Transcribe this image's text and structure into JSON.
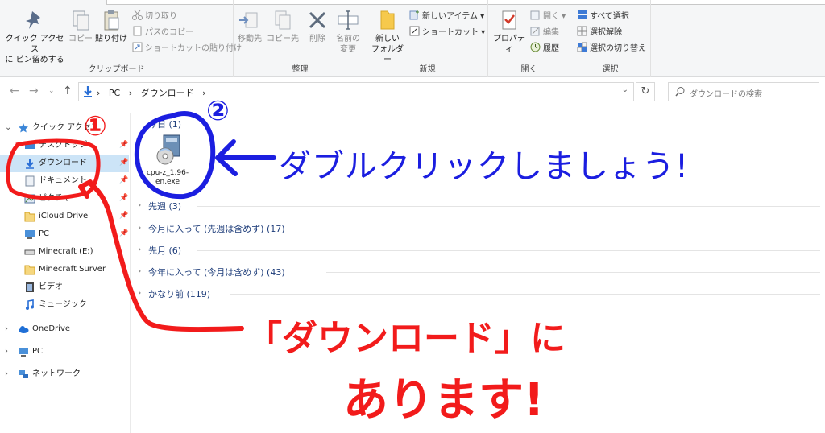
{
  "ribbon": {
    "clipboard": {
      "pin_label_line1": "クイック アクセス",
      "pin_label_line2": "に ピン留めする",
      "copy_label": "コピー",
      "paste_label": "貼り付け",
      "cut_label": "切り取り",
      "copy_path_label": "パスのコピー",
      "paste_shortcut_label": "ショートカットの貼り付け",
      "group_label": "クリップボード"
    },
    "organize": {
      "move_label": "移動先",
      "copy_to_label": "コピー先",
      "delete_label": "削除",
      "rename_label_line1": "名前の",
      "rename_label_line2": "変更",
      "group_label": "整理"
    },
    "new": {
      "new_folder_line1": "新しい",
      "new_folder_line2": "フォルダー",
      "new_item_label": "新しいアイテム ▾",
      "shortcut_label": "ショートカット ▾",
      "group_label": "新規"
    },
    "open": {
      "properties_label": "プロパティ",
      "open_label": "開く ▾",
      "edit_label": "編集",
      "history_label": "履歴",
      "group_label": "開く"
    },
    "select": {
      "select_all_label": "すべて選択",
      "select_none_label": "選択解除",
      "invert_label": "選択の切り替え",
      "group_label": "選択"
    }
  },
  "address": {
    "path_pc": "PC",
    "path_sep": "›",
    "path_folder": "ダウンロード",
    "search_placeholder": "ダウンロードの検索"
  },
  "nav": {
    "quick_access": "クイック アクセス",
    "items": [
      {
        "label": "デスクトップ"
      },
      {
        "label": "ダウンロード"
      },
      {
        "label": "ドキュメント"
      },
      {
        "label": "ピクチャ"
      },
      {
        "label": "iCloud Drive"
      },
      {
        "label": "PC"
      },
      {
        "label": "Minecraft (E:)"
      },
      {
        "label": "Minecraft Surver"
      },
      {
        "label": "ビデオ"
      },
      {
        "label": "ミュージック"
      }
    ],
    "onedrive": "OneDrive",
    "pc": "PC",
    "network": "ネットワーク"
  },
  "content": {
    "groups": [
      {
        "label": "今日 (1)"
      },
      {
        "label": "先週 (3)"
      },
      {
        "label": "今月に入って (先週は含めず) (17)"
      },
      {
        "label": "先月 (6)"
      },
      {
        "label": "今年に入って (今月は含めず) (43)"
      },
      {
        "label": "かなり前 (119)"
      }
    ],
    "file": {
      "name_line1": "cpu-z_1.96-",
      "name_line2": "en.exe"
    }
  },
  "annotations": {
    "num1": "①",
    "num2": "②",
    "blue_text": "ダブルクリックしましょう!",
    "red_text_line1": "「ダウンロード」に",
    "red_text_line2": "あります!",
    "red_color": "#f21b1b",
    "blue_color": "#1b1ee0"
  }
}
